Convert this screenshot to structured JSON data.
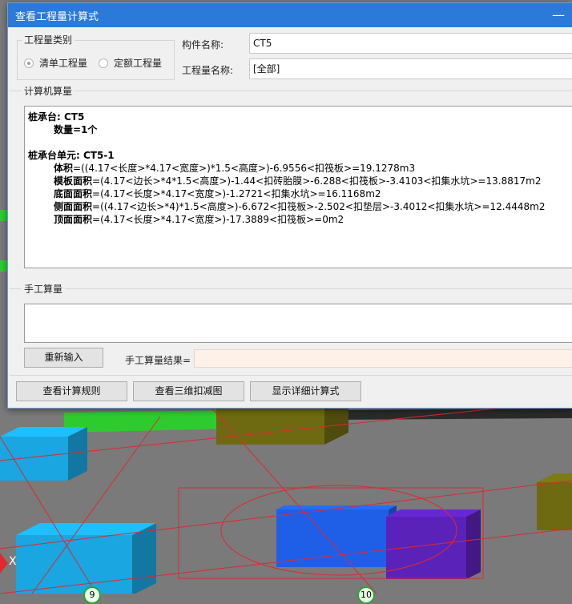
{
  "dialog": {
    "title": "查看工程量计算式",
    "minimize_glyph": "—"
  },
  "quantity_type": {
    "group_label": "工程量类别",
    "options": [
      {
        "label": "清单工程量",
        "checked": true
      },
      {
        "label": "定额工程量",
        "checked": false
      }
    ]
  },
  "component": {
    "name_label": "构件名称:",
    "name_value": "CT5",
    "quantity_label": "工程量名称:",
    "quantity_value": "[全部]"
  },
  "computer_calc": {
    "section_label": "计算机算量",
    "lines": [
      {
        "text": "桩承台: CT5",
        "bold": true,
        "indent": false
      },
      {
        "text": "数量=1个",
        "bold": false,
        "indent": true,
        "bold_prefix": "数量"
      },
      {
        "text": "",
        "blank": true
      },
      {
        "text": "桩承台单元: CT5-1",
        "bold": true,
        "indent": false
      },
      {
        "prefix": "体积",
        "rest": "=((4.17<长度>*4.17<宽度>)*1.5<高度>)-6.9556<扣筏板>=19.1278m3"
      },
      {
        "prefix": "模板面积",
        "rest": "=(4.17<边长>*4*1.5<高度>)-1.44<扣砖胎膜>-6.288<扣筏板>-3.4103<扣集水坑>=13.8817m2"
      },
      {
        "prefix": "底面面积",
        "rest": "=(4.17<长度>*4.17<宽度>)-1.2721<扣集水坑>=16.1168m2"
      },
      {
        "prefix": "侧面面积",
        "rest": "=((4.17<边长>*4)*1.5<高度>)-6.672<扣筏板>-2.502<扣垫层>-3.4012<扣集水坑>=12.4448m2"
      },
      {
        "prefix": "顶面面积",
        "rest": "=(4.17<长度>*4.17<宽度>)-17.3889<扣筏板>=0m2"
      }
    ]
  },
  "manual_calc": {
    "section_label": "手工算量",
    "reinput_button": "重新输入",
    "result_label": "手工算量结果=",
    "result_value": ""
  },
  "footer": {
    "view_rules_button": "查看计算规则",
    "view_3d_button": "查看三维扣减图",
    "show_detail_button": "显示详细计算式"
  },
  "viewport": {
    "axis_x_label": "X",
    "axis_bubble_left": "9",
    "axis_bubble_right": "10",
    "colors": {
      "ground": "#7a7a7a",
      "cyan_block": "#1aa6e0",
      "olive_block": "#6e6a12",
      "blue_block": "#1f5fe8",
      "purple_block": "#5a22b8",
      "green_beam": "#2ecb2e",
      "grid_line": "#e0282e"
    }
  }
}
